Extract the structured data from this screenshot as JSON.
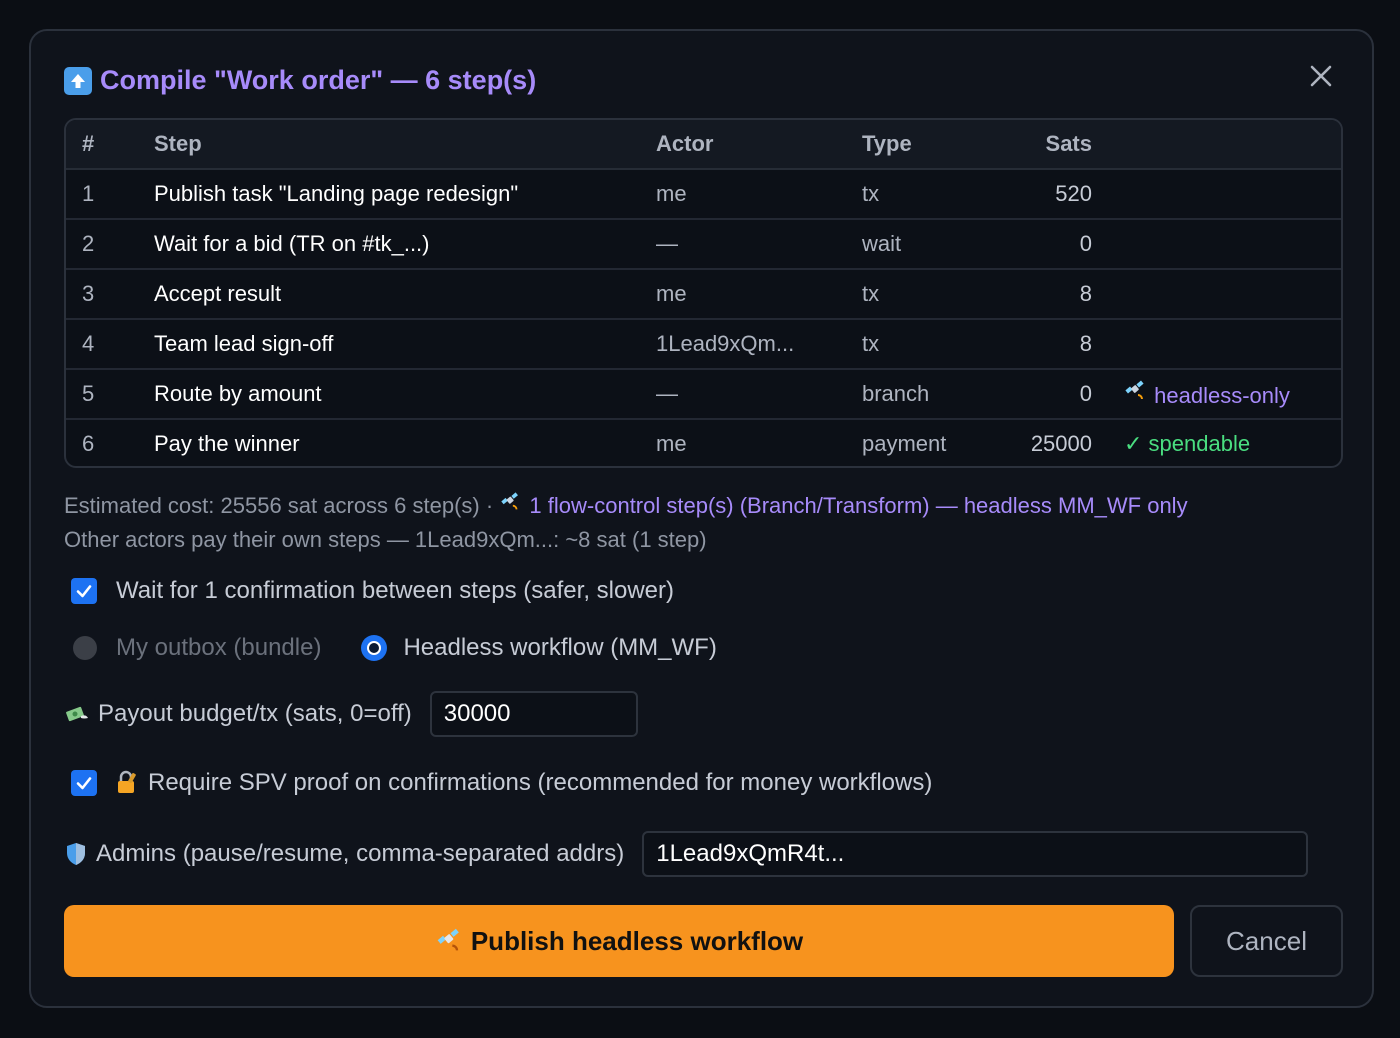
{
  "dialog": {
    "title": "Compile \"Work order\" — 6 step(s)",
    "title_icon": "up-arrow-icon",
    "close_icon": "close-icon"
  },
  "table": {
    "headers": {
      "num": "#",
      "step": "Step",
      "actor": "Actor",
      "type": "Type",
      "sats": "Sats"
    },
    "rows": [
      {
        "num": "1",
        "step": "Publish task \"Landing page redesign\"",
        "actor": "me",
        "type": "tx",
        "sats": "520",
        "tag": "",
        "tag_icon": ""
      },
      {
        "num": "2",
        "step": "Wait for a bid (TR on #tk_...)",
        "actor": "—",
        "type": "wait",
        "sats": "0",
        "tag": "",
        "tag_icon": ""
      },
      {
        "num": "3",
        "step": "Accept result",
        "actor": "me",
        "type": "tx",
        "sats": "8",
        "tag": "",
        "tag_icon": ""
      },
      {
        "num": "4",
        "step": "Team lead sign-off",
        "actor": "1Lead9xQm...",
        "type": "tx",
        "sats": "8",
        "tag": "",
        "tag_icon": ""
      },
      {
        "num": "5",
        "step": "Route by amount",
        "actor": "—",
        "type": "branch",
        "sats": "0",
        "tag": "headless-only",
        "tag_icon": "satellite-icon"
      },
      {
        "num": "6",
        "step": "Pay the winner",
        "actor": "me",
        "type": "payment",
        "sats": "25000",
        "tag": "spendable",
        "tag_icon": "check-icon"
      }
    ]
  },
  "summary": {
    "estimate": "Estimated cost: 25556 sat across 6 step(s) · ",
    "flow_note": "1 flow-control step(s) (Branch/Transform) — headless MM_WF only",
    "other_actors": "Other actors pay their own steps — 1Lead9xQm...: ~8 sat (1 step)"
  },
  "options": {
    "wait_confirm_label": "Wait for 1 confirmation between steps (safer, slower)",
    "wait_confirm_checked": true,
    "mode_outbox_label": "My outbox (bundle)",
    "mode_headless_label": "Headless workflow (MM_WF)",
    "selected_mode": "headless",
    "payout_label": "Payout budget/tx (sats, 0=off)",
    "payout_value": "30000",
    "spv_label": "Require SPV proof on confirmations (recommended for money workflows)",
    "spv_checked": true,
    "admins_label": "Admins (pause/resume, comma-separated addrs)",
    "admins_value": "1Lead9xQmR4t..."
  },
  "actions": {
    "publish_label": "Publish headless workflow",
    "cancel_label": "Cancel"
  },
  "colors": {
    "accent_violet": "#a78bfa",
    "accent_orange": "#f7931e",
    "accent_blue": "#1d72f2",
    "success_green": "#4ade80"
  }
}
